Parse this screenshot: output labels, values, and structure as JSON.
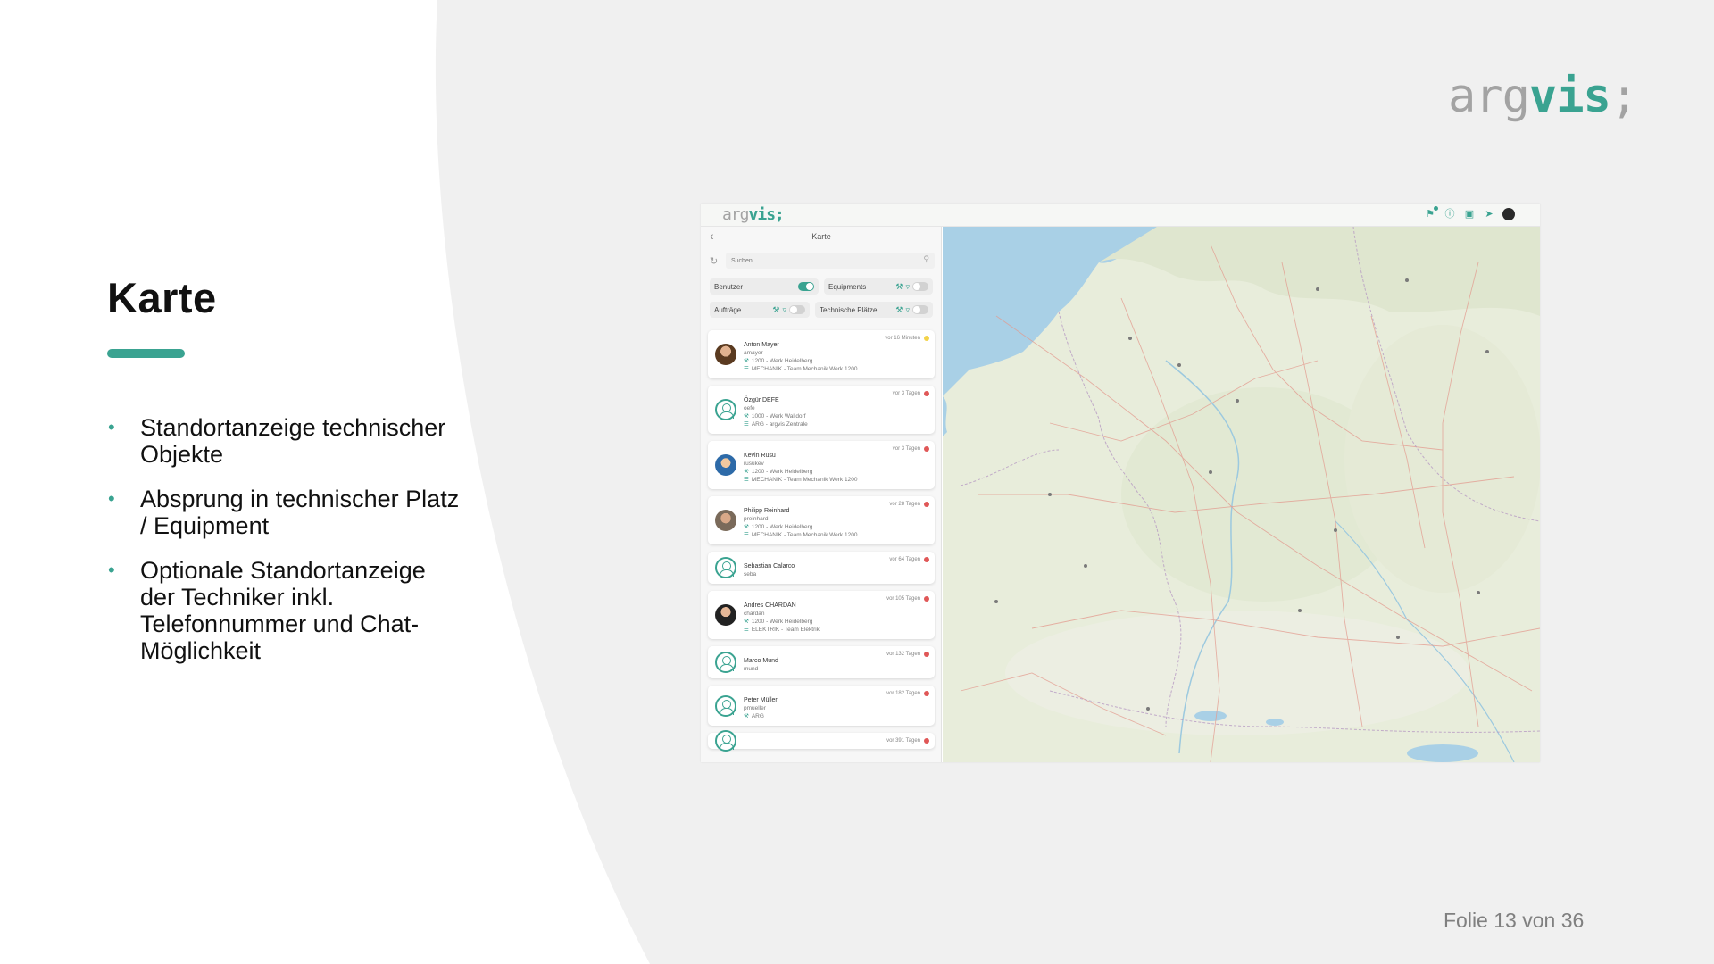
{
  "slide": {
    "title": "Karte",
    "bullets": [
      "Standortanzeige technischer Objekte",
      "Absprung in technischer Platz / Equipment",
      "Optionale Standortanzeige der Techniker inkl. Telefonnummer und Chat-Möglichkeit"
    ],
    "footer": "Folie 13 von 36",
    "brand": {
      "part1": "arg",
      "part2": "vis",
      "part3": ";"
    },
    "colors": {
      "accent": "#3aa391",
      "brand_gray": "#a3a3a3",
      "panel_bg": "#f0f0f0"
    }
  },
  "app": {
    "logo": {
      "part1": "arg",
      "part2": "vis;"
    },
    "header_icons": [
      "bell-icon",
      "help-icon",
      "chat-icon",
      "send-icon",
      "avatar"
    ],
    "sidebar": {
      "title": "Karte",
      "search_placeholder": "Suchen",
      "toggles": [
        {
          "label": "Benutzer",
          "on": true
        },
        {
          "label": "Equipments",
          "on": false
        },
        {
          "label": "Aufträge",
          "on": false
        },
        {
          "label": "Technische Plätze",
          "on": false
        }
      ],
      "users": [
        {
          "name": "Anton Mayer",
          "login": "amayer",
          "plant": "1200 - Werk Heidelberg",
          "team": "MECHANIK - Team Mechanik Werk 1200",
          "time": "vor 16 Minuten",
          "status": "yellow",
          "avatar": "photo"
        },
        {
          "name": "Özgür DEFE",
          "login": "oefe",
          "plant": "1000 - Werk Walldorf",
          "team": "ARG - argvis Zentrale",
          "time": "vor 3 Tagen",
          "status": "red",
          "avatar": "generic"
        },
        {
          "name": "Kevin Rusu",
          "login": "rusukev",
          "plant": "1200 - Werk Heidelberg",
          "team": "MECHANIK - Team Mechanik Werk 1200",
          "time": "vor 3 Tagen",
          "status": "red",
          "avatar": "photo p2"
        },
        {
          "name": "Philipp Reinhard",
          "login": "preinhard",
          "plant": "1200 - Werk Heidelberg",
          "team": "MECHANIK - Team Mechanik Werk 1200",
          "time": "vor 28 Tagen",
          "status": "red",
          "avatar": "photo p3"
        },
        {
          "name": "Sebastian Calarco",
          "login": "seba",
          "plant": "",
          "team": "",
          "time": "vor 64 Tagen",
          "status": "red",
          "avatar": "generic"
        },
        {
          "name": "Andres CHARDAN",
          "login": "chardan",
          "plant": "1200 - Werk Heidelberg",
          "team": "ELEKTRIK - Team Elektrik",
          "time": "vor 105 Tagen",
          "status": "red",
          "avatar": "photo p4"
        },
        {
          "name": "Marco Mund",
          "login": "mund",
          "plant": "",
          "team": "",
          "time": "vor 132 Tagen",
          "status": "red",
          "avatar": "generic"
        },
        {
          "name": "Peter Müller",
          "login": "pmueller",
          "plant": "ARG",
          "team": "",
          "time": "vor 182 Tagen",
          "status": "red",
          "avatar": "generic"
        },
        {
          "name": "",
          "login": "",
          "plant": "",
          "team": "",
          "time": "vor 391 Tagen",
          "status": "red",
          "avatar": "generic"
        }
      ]
    }
  }
}
